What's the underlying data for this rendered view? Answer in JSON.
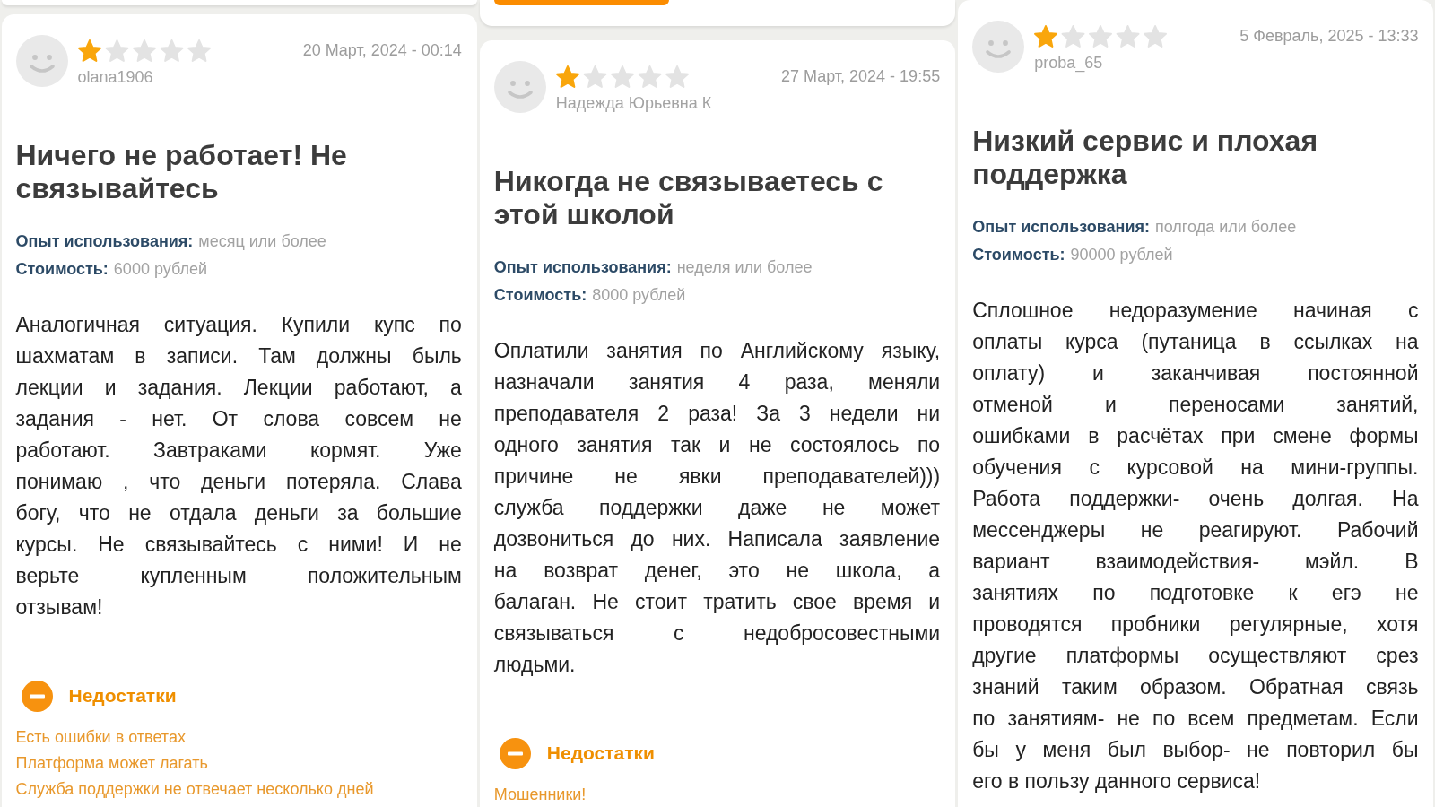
{
  "columns": [
    {
      "card_above": {
        "button": false
      },
      "review": {
        "username": "olana1906",
        "stars": 1,
        "date": "20 Март, 2024 - 00:14",
        "title": "Ничего не работает! Не связывайтесь",
        "details": [
          {
            "label": "Опыт использования:",
            "value": "месяц или более"
          },
          {
            "label": "Стоимость:",
            "value": "6000 рублей"
          }
        ],
        "text_lines": [
          "Аналогичная ситуация. Купили купс по",
          "шахматам в записи. Там должны быль",
          "лекции и задания. Лекции работают, а",
          "задания - нет. От слова совсем не",
          "работают. Завтраками кормят. Уже",
          "понимаю , что деньги потеряла. Слава",
          "богу, что не отдала деньги за большие",
          "курсы. Не связывайтесь с ними! И не",
          "верьте купленным положительным",
          "отзывам!"
        ],
        "cons": {
          "heading": "Недостатки",
          "items": [
            "Есть ошибки в ответах",
            "Платформа может лагать",
            "Служба поддержки не отвечает несколько дней"
          ]
        }
      }
    },
    {
      "card_above": {
        "button": true
      },
      "review": {
        "username": "Надежда Юрьевна К",
        "stars": 1,
        "date": "27 Март, 2024 - 19:55",
        "title": "Никогда не связываетесь с этой школой",
        "details": [
          {
            "label": "Опыт использования:",
            "value": "неделя или более"
          },
          {
            "label": "Стоимость:",
            "value": "8000 рублей"
          }
        ],
        "text_lines": [
          "Оплатили занятия по Английскому языку,",
          "назначали занятия 4 раза, меняли",
          "преподавателя 2 раза! За 3 недели ни",
          "одного занятия так и не состоялось по",
          "причине не явки преподавателей)))",
          "служба поддержки даже не может",
          "дозвониться до них. Написала заявление",
          "на возврат денег, это не школа, а",
          "балаган. Не стоит тратить свое время и",
          "связываться с недобросовестными",
          "людьми."
        ],
        "cons": {
          "heading": "Недостатки",
          "items": [
            "Мошенники!"
          ]
        }
      }
    },
    {
      "review": {
        "username": "proba_65",
        "stars": 1,
        "date": "5 Февраль, 2025 - 13:33",
        "title": "Низкий сервис и плохая поддержка",
        "details": [
          {
            "label": "Опыт использования:",
            "value": "полгода или более"
          },
          {
            "label": "Стоимость:",
            "value": "90000 рублей"
          }
        ],
        "text_lines": [
          "Сплошное недоразумение начиная с",
          "оплаты курса (путаница в ссылках на",
          "оплату) и заканчивая постоянной",
          "отменой и переносами занятий,",
          "ошибками в расчётах при смене формы",
          "обучения с курсовой на мини-группы.",
          "Работа поддержки- очень долгая. На",
          "мессенджеры не реагируют. Рабочий",
          "вариант взаимодействия- мэйл. В",
          "занятиях по подготовке к егэ не",
          "проводятся пробники регулярные, хотя",
          "другие платформы осуществляют срез",
          "знаний таким образом. Обратная связь",
          "по занятиям- не по всем предметам. Если",
          "бы у меня был выбор- не повторил бы",
          "его в пользу данного сервиса!"
        ]
      }
    }
  ]
}
